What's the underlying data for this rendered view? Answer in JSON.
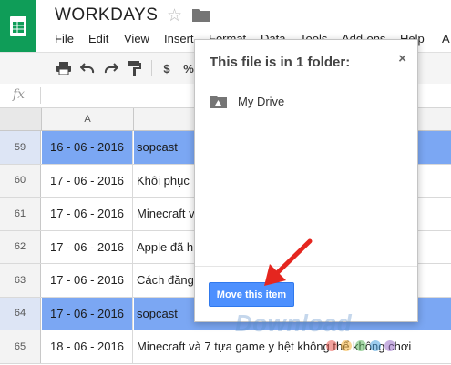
{
  "header": {
    "title": "WORKDAYS",
    "menu": [
      "File",
      "Edit",
      "View",
      "Insert",
      "Format",
      "Data",
      "Tools",
      "Add-ons",
      "Help",
      "A"
    ]
  },
  "toolbar": {
    "items": [
      "print-icon",
      "undo-icon",
      "redo-icon",
      "paint-format-icon",
      "$",
      "%"
    ]
  },
  "formula_bar": {
    "fx_label": "fx"
  },
  "grid": {
    "column_headers": [
      "A"
    ],
    "rows": [
      {
        "num": "59",
        "date": "16 - 06 - 2016",
        "text": "sopcast",
        "selected": true
      },
      {
        "num": "60",
        "date": "17 - 06 - 2016",
        "text": "Khôi phục",
        "selected": false
      },
      {
        "num": "61",
        "date": "17 - 06 - 2016",
        "text": "Minecraft v",
        "selected": false
      },
      {
        "num": "62",
        "date": "17 - 06 - 2016",
        "text": "Apple đã h",
        "selected": false
      },
      {
        "num": "63",
        "date": "17 - 06 - 2016",
        "text": "Cách đăng",
        "selected": false
      },
      {
        "num": "64",
        "date": "17 - 06 - 2016",
        "text": "sopcast",
        "selected": true
      },
      {
        "num": "65",
        "date": "18 - 06 - 2016",
        "text": "Minecraft và 7 tựa game y hệt không thể không chơi",
        "selected": false
      }
    ]
  },
  "popup": {
    "title": "This file is in 1 folder:",
    "close_label": "×",
    "folder_name": "My Drive",
    "move_button_label": "Move this item"
  },
  "watermark": {
    "text": "Download.com.vn"
  },
  "colors": {
    "sheets_green": "#0f9d58",
    "selection_blue": "#7ba7f3",
    "button_blue": "#4d90fe",
    "arrow_red": "#e5261f"
  }
}
